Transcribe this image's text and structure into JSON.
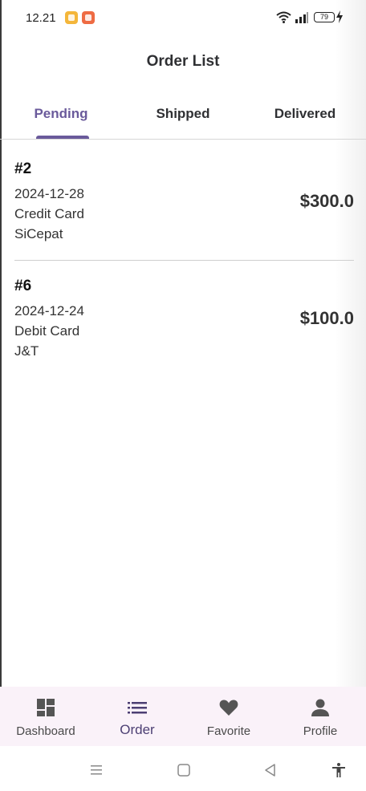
{
  "status_bar": {
    "time": "12.21",
    "battery": "79"
  },
  "header": {
    "title": "Order List"
  },
  "tabs": [
    {
      "label": "Pending",
      "active": true
    },
    {
      "label": "Shipped",
      "active": false
    },
    {
      "label": "Delivered",
      "active": false
    }
  ],
  "orders": [
    {
      "id": "#2",
      "date": "2024-12-28",
      "payment": "Credit Card",
      "courier": "SiCepat",
      "total": "$300.0"
    },
    {
      "id": "#6",
      "date": "2024-12-24",
      "payment": "Debit Card",
      "courier": "J&T",
      "total": "$100.0"
    }
  ],
  "bottom_nav": [
    {
      "label": "Dashboard",
      "icon": "dashboard-icon",
      "active": false
    },
    {
      "label": "Order",
      "icon": "list-icon",
      "active": true
    },
    {
      "label": "Favorite",
      "icon": "heart-icon",
      "active": false
    },
    {
      "label": "Profile",
      "icon": "person-icon",
      "active": false
    }
  ],
  "colors": {
    "accent": "#6a5a9b",
    "nav_background": "#faf2f9",
    "text_primary": "#2f3033"
  }
}
